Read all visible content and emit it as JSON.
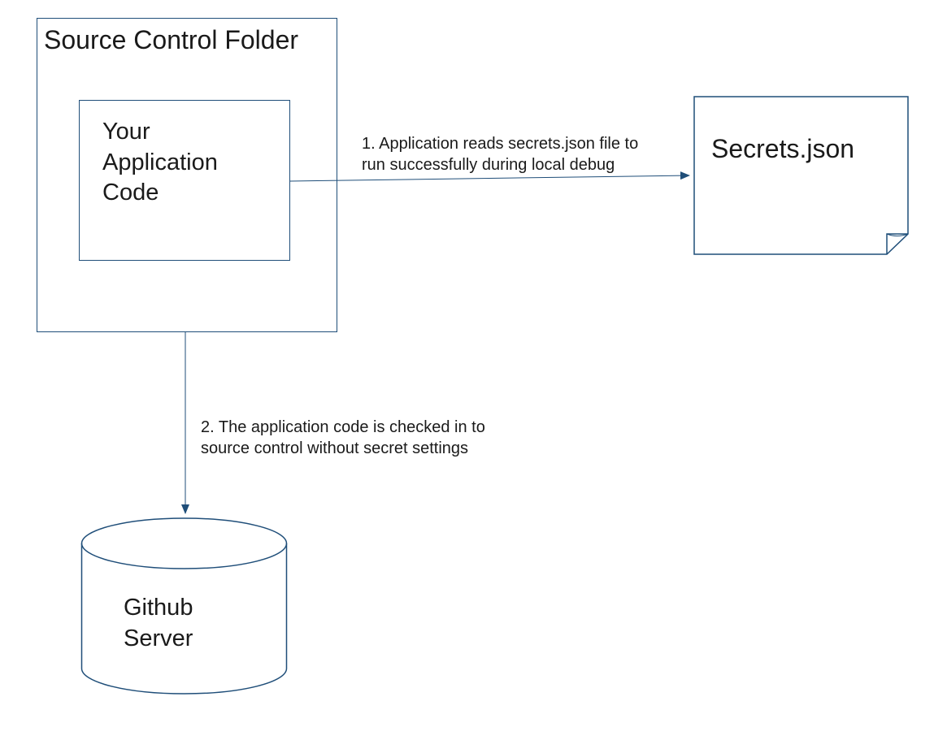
{
  "diagram": {
    "source_control_folder": {
      "title": "Source Control Folder",
      "app_code": "Your\nApplication\nCode"
    },
    "secrets_doc": "Secrets.json",
    "github_server": "Github\nServer",
    "arrows": {
      "to_secrets": "1. Application reads secrets.json file to\nrun successfully during local debug",
      "to_github": "2. The application code is checked in to\nsource control without secret settings"
    }
  },
  "colors": {
    "border": "#1f4e79",
    "text": "#1a1a1a"
  }
}
